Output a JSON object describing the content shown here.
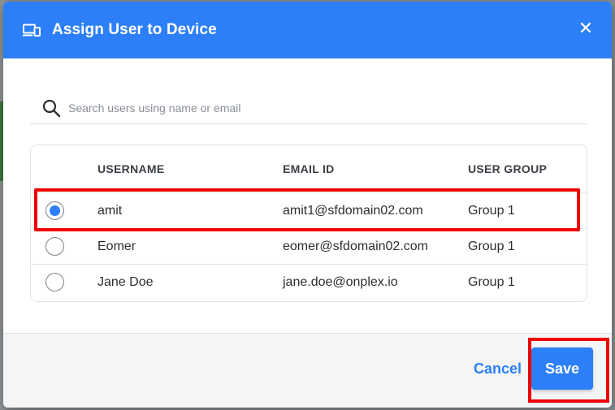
{
  "dialog": {
    "title": "Assign User to Device",
    "icon": "devices-icon",
    "close_glyph": "✕"
  },
  "search": {
    "placeholder": "Search users using name or email",
    "value": ""
  },
  "table": {
    "headers": [
      "USERNAME",
      "EMAIL ID",
      "USER GROUP"
    ],
    "rows": [
      {
        "username": "amit",
        "email": "amit1@sfdomain02.com",
        "group": "Group 1",
        "selected": true
      },
      {
        "username": "Eomer",
        "email": "eomer@sfdomain02.com",
        "group": "Group 1",
        "selected": false
      },
      {
        "username": "Jane Doe",
        "email": "jane.doe@onplex.io",
        "group": "Group 1",
        "selected": false
      }
    ]
  },
  "footer": {
    "cancel_label": "Cancel",
    "save_label": "Save"
  },
  "colors": {
    "accent": "#2d7ff9",
    "highlight": "#ee0000"
  }
}
